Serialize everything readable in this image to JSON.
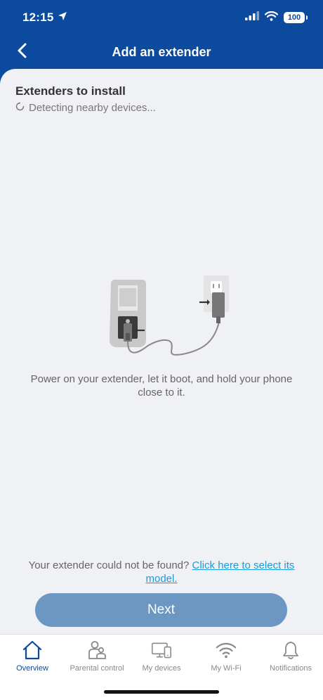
{
  "status_bar": {
    "time": "12:15",
    "battery": "100",
    "icons": [
      "location-arrow-icon",
      "cellular-signal-icon",
      "wifi-icon",
      "battery-icon"
    ]
  },
  "header": {
    "title": "Add an extender",
    "back_icon": "chevron-left-icon"
  },
  "main": {
    "section_title": "Extenders to install",
    "detecting_text": "Detecting nearby devices...",
    "illustration_icon": "extender-plug-illustration",
    "instructions": "Power on your extender, let it boot, and hold your phone close to it.",
    "not_found_text": "Your extender could not be found?",
    "model_link": "Click here to select its model.",
    "next_label": "Next"
  },
  "tab_bar": {
    "items": [
      {
        "label": "Overview",
        "icon": "home-icon",
        "active": true
      },
      {
        "label": "Parental control",
        "icon": "family-icon",
        "active": false
      },
      {
        "label": "My devices",
        "icon": "devices-icon",
        "active": false
      },
      {
        "label": "My Wi-Fi",
        "icon": "wifi-icon",
        "active": false
      },
      {
        "label": "Notifications",
        "icon": "bell-icon",
        "active": false
      }
    ]
  },
  "colors": {
    "brand_blue": "#0b4a9c",
    "button_blue": "#6b97c2",
    "link_blue": "#1a9bd7",
    "background": "#f0f1f5"
  }
}
